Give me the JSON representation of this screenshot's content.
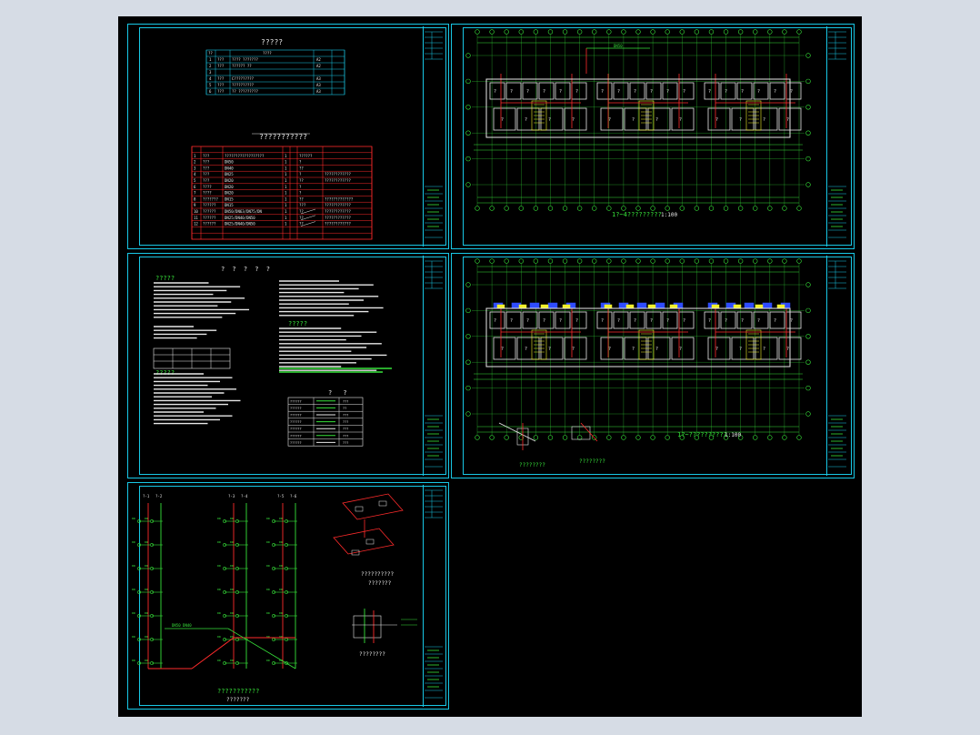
{
  "drawing_set": {
    "sheet_1": {
      "title": "?????",
      "table_a_rows": [
        [
          "1",
          "???",
          "????  ???????",
          "A2"
        ],
        [
          "2",
          "???",
          "?????? ??",
          "A2"
        ],
        [
          "3",
          "",
          "",
          ""
        ],
        [
          "4",
          "???",
          "C?????????",
          "A3"
        ],
        [
          "5",
          "???",
          "??????????",
          "A3"
        ],
        [
          "6",
          "???",
          "?? ?????????",
          "A3"
        ]
      ],
      "table_b_title": "???????????",
      "table_b_rows": [
        [
          "1",
          "???",
          "??????????????????",
          "1",
          "??????"
        ],
        [
          "2",
          "???",
          "DN50",
          "1",
          "?"
        ],
        [
          "3",
          "???",
          "DN40",
          "1",
          "??"
        ],
        [
          "4",
          "???",
          "DN25",
          "1",
          "?",
          "????????????"
        ],
        [
          "5",
          "???",
          "DN20",
          "1",
          "??",
          "????????????"
        ],
        [
          "6",
          "????",
          "DN20",
          "1",
          "?"
        ],
        [
          "7",
          "????",
          "DN20",
          "1",
          "?"
        ],
        [
          "8",
          "???????",
          "DN15",
          "1",
          "??",
          "?????????????"
        ],
        [
          "9",
          "??????",
          "DN15",
          "1",
          "???",
          "????????????"
        ],
        [
          "10",
          "??????",
          "DN50/DN63/DN75/DN",
          "1",
          "??",
          "????????????"
        ],
        [
          "11",
          "??????",
          "DN25/DN40/DN50",
          "1",
          "??",
          "????????????"
        ],
        [
          "12",
          "??????",
          "DN25/DN40/DN50",
          "1",
          "??",
          "????????????"
        ]
      ]
    },
    "sheet_2": {
      "caption": "1?~4?????????",
      "scale": "1:100"
    },
    "sheet_3": {
      "title": "? ? ? ? ?",
      "section_1": "?????",
      "section_2": "?????",
      "section_3": "?????",
      "legend_title": "? ?",
      "legend_rows": [
        [
          "??????",
          "???"
        ],
        [
          "??????",
          "??"
        ],
        [
          "??????",
          "???"
        ],
        [
          "??????",
          "???"
        ],
        [
          "??????",
          "???"
        ],
        [
          "??????",
          "???"
        ],
        [
          "??????",
          "???"
        ]
      ]
    },
    "sheet_4": {
      "caption": "1?~??????????",
      "scale": "1:100",
      "detail_1": "????????",
      "detail_2": "????????"
    },
    "sheet_5": {
      "caption": "???????????",
      "sub_caption": "???????",
      "axo_caption": "??????????",
      "axo_sub": "???????",
      "detail_caption": "????????"
    },
    "colors": {
      "frame": "#18c8e6",
      "background": "#000000",
      "text": "#e8e8e8",
      "green": "#37e23a",
      "red": "#ff2b2b",
      "yellow": "#f1f12a",
      "blue": "#2f4cff",
      "paper_bg": "#d6dce5"
    }
  }
}
